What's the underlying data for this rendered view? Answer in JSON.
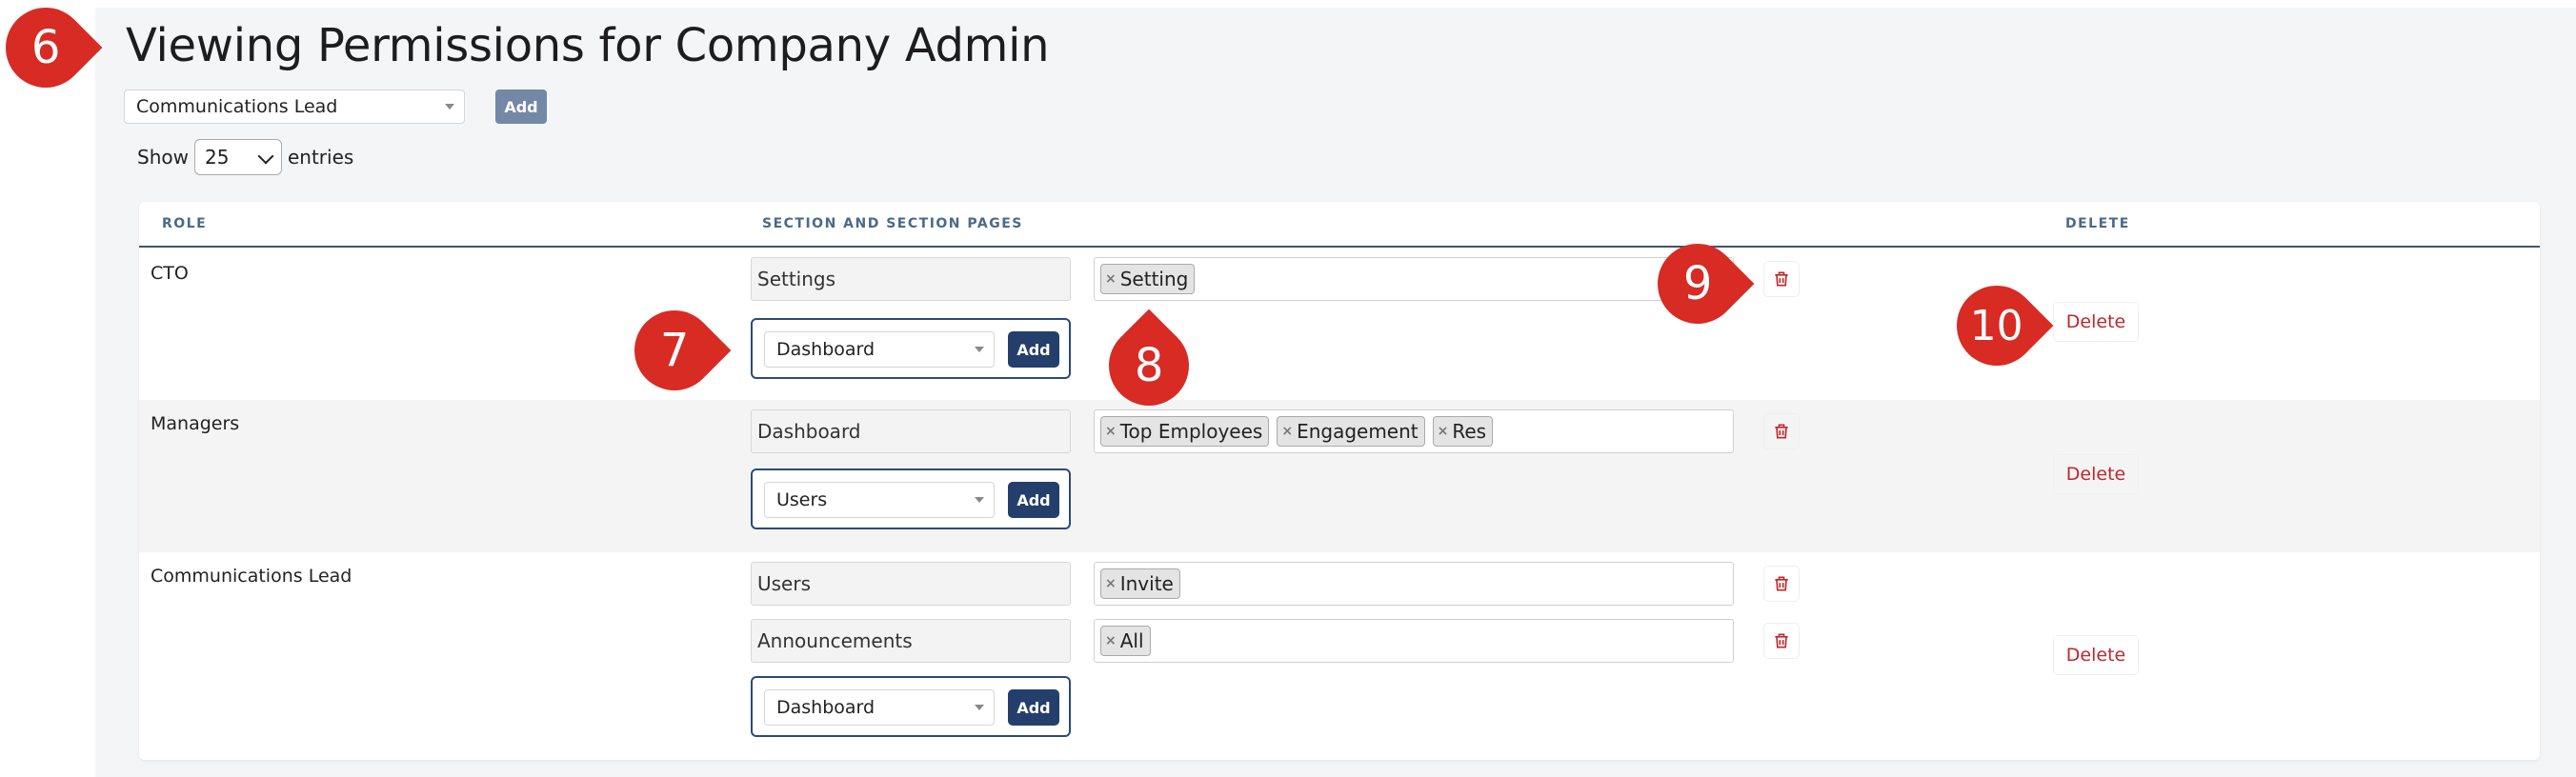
{
  "header": {
    "title": "Viewing Permissions for Company Admin",
    "role_select_value": "Communications Lead",
    "add_label": "Add"
  },
  "entries": {
    "show_label": "Show",
    "value": "25",
    "entries_label": "entries"
  },
  "table": {
    "columns": [
      "ROLE",
      "SECTION AND SECTION PAGES",
      "DELETE"
    ],
    "add_label": "Add",
    "delete_label": "Delete",
    "rows": [
      {
        "role": "CTO",
        "sections": [
          {
            "section": "Settings",
            "pages": [
              "Setting"
            ]
          }
        ],
        "add_select_value": "Dashboard"
      },
      {
        "role": "Managers",
        "sections": [
          {
            "section": "Dashboard",
            "pages": [
              "Top Employees",
              "Engagement",
              "Res"
            ]
          }
        ],
        "add_select_value": "Users"
      },
      {
        "role": "Communications Lead",
        "sections": [
          {
            "section": "Users",
            "pages": [
              "Invite"
            ]
          },
          {
            "section": "Announcements",
            "pages": [
              "All"
            ]
          }
        ],
        "add_select_value": "Dashboard"
      }
    ]
  },
  "annotations": [
    "6",
    "7",
    "8",
    "9",
    "10"
  ],
  "colors": {
    "marker": "#d72b24",
    "primary_button": "#243f6b",
    "delete_text": "#c1272d",
    "header_text": "#4a6a88"
  }
}
